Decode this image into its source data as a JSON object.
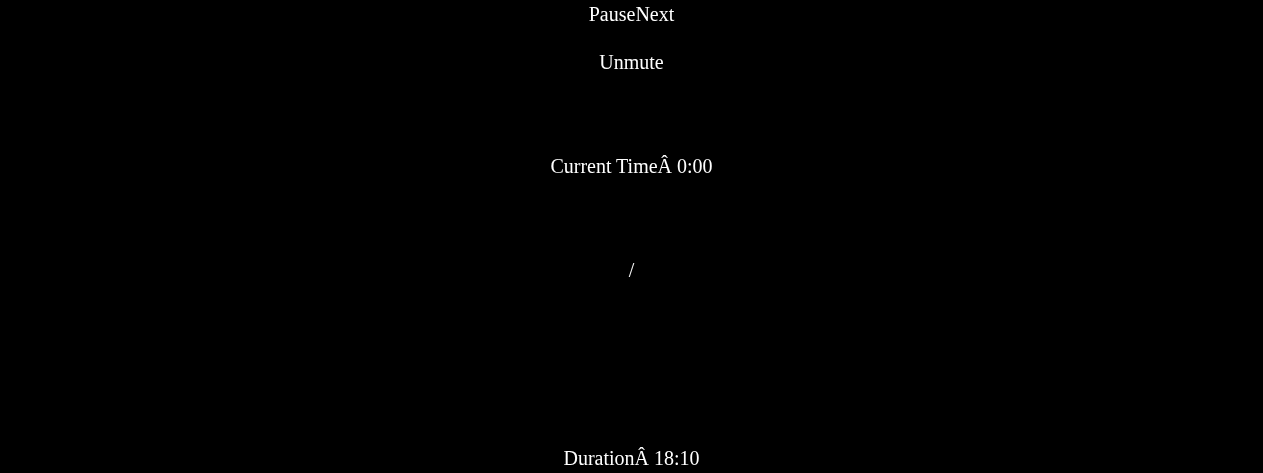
{
  "controls": [
    {
      "kind": "button",
      "label": "Pause"
    },
    {
      "kind": "button",
      "label": "Next"
    }
  ],
  "mute": {
    "label": "Unmute"
  },
  "current_time": "Current TimeÂ 0:00",
  "separator": "/",
  "duration": "DurationÂ 18:10"
}
